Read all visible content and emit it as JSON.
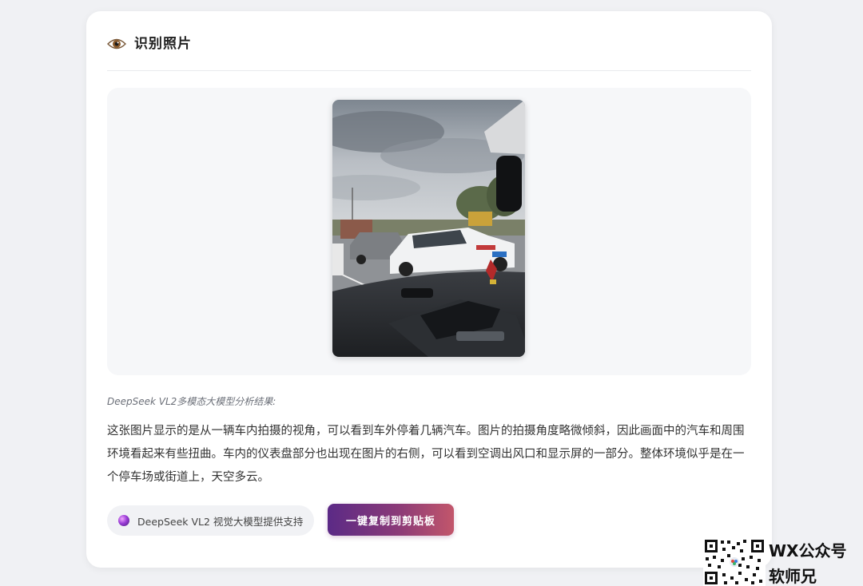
{
  "card": {
    "title": "识别照片",
    "title_icon": "eye-icon"
  },
  "photo": {
    "subject": "car-interior-street-photo"
  },
  "result": {
    "caption": "DeepSeek VL2多模态大模型分析结果:",
    "text": "这张图片显示的是从一辆车内拍摄的视角，可以看到车外停着几辆汽车。图片的拍摄角度略微倾斜，因此画面中的汽车和周围环境看起来有些扭曲。车内的仪表盘部分也出现在图片的右侧，可以看到空调出风口和显示屏的一部分。整体环境似乎是在一个停车场或街道上，天空多云。"
  },
  "footer": {
    "support_label": "DeepSeek VL2 视觉大模型提供支持",
    "support_icon": "orb-icon",
    "copy_button_label": "一键复制到剪贴板",
    "button_gradient": [
      "#5b2a86",
      "#c2566b"
    ]
  },
  "watermark": {
    "line1": "WX公众号",
    "line2": "软师兄"
  }
}
